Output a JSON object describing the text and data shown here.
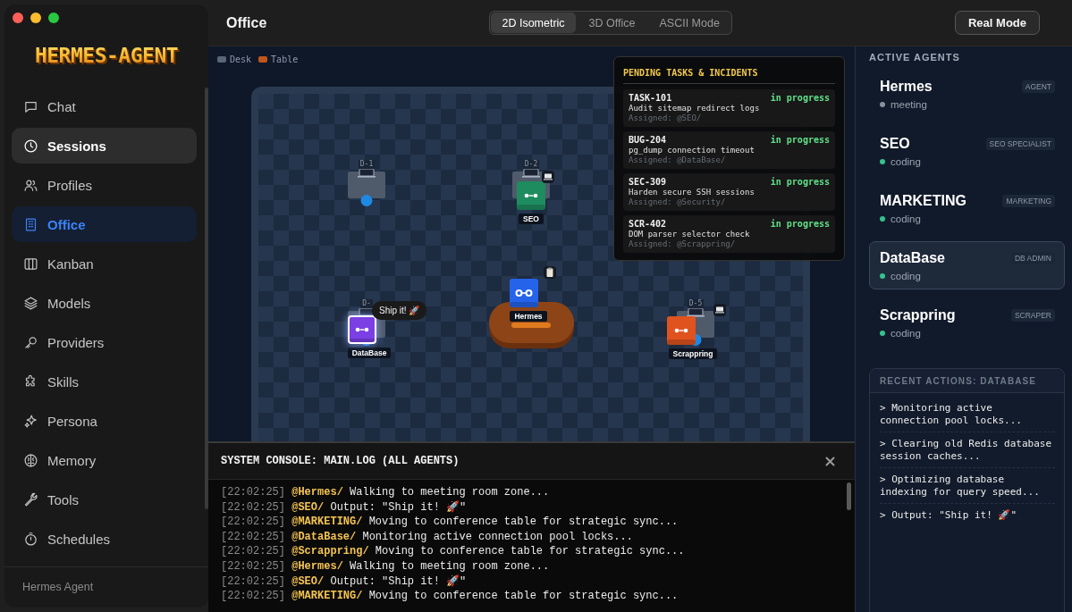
{
  "sidebar": {
    "logo": "HERMES-AGENT",
    "items": [
      {
        "label": "Chat",
        "selected": false,
        "hovered": false
      },
      {
        "label": "Sessions",
        "selected": false,
        "hovered": true
      },
      {
        "label": "Profiles",
        "selected": false,
        "hovered": false
      },
      {
        "label": "Office",
        "selected": true,
        "hovered": false
      },
      {
        "label": "Kanban",
        "selected": false,
        "hovered": false
      },
      {
        "label": "Models",
        "selected": false,
        "hovered": false
      },
      {
        "label": "Providers",
        "selected": false,
        "hovered": false
      },
      {
        "label": "Skills",
        "selected": false,
        "hovered": false
      },
      {
        "label": "Persona",
        "selected": false,
        "hovered": false
      },
      {
        "label": "Memory",
        "selected": false,
        "hovered": false
      },
      {
        "label": "Tools",
        "selected": false,
        "hovered": false
      },
      {
        "label": "Schedules",
        "selected": false,
        "hovered": false
      }
    ],
    "footer": "Hermes Agent"
  },
  "header": {
    "title": "Office",
    "view_tabs": [
      {
        "label": "2D Isometric",
        "selected": true
      },
      {
        "label": "3D Office",
        "selected": false
      },
      {
        "label": "ASCII Mode",
        "selected": false
      }
    ],
    "mode_button": "Real Mode"
  },
  "office": {
    "legend": [
      {
        "label": "Desk",
        "color": "#5a6578"
      },
      {
        "label": "Table",
        "color": "#c2551b"
      }
    ],
    "desks": [
      {
        "label": "D-1"
      },
      {
        "label": "D-2"
      },
      {
        "label": "D-"
      },
      {
        "label": "D-5"
      }
    ],
    "agents": [
      {
        "name": "SEO",
        "color": "#1e8c5e",
        "kind": "dots",
        "selected": false
      },
      {
        "name": "Hermes",
        "color": "#2563eb",
        "kind": "rings",
        "selected": false
      },
      {
        "name": "DataBase",
        "color": "#7b3fe4",
        "kind": "dots",
        "selected": true,
        "bubble": "Ship it! 🚀"
      },
      {
        "name": "Scrappring",
        "color": "#e0531f",
        "kind": "dots",
        "selected": false
      }
    ],
    "tasks_panel": {
      "title": "PENDING TASKS & INCIDENTS",
      "tasks": [
        {
          "id": "TASK-101",
          "status": "in progress",
          "description": "Audit sitemap redirect logs",
          "assigned": "Assigned: @SEO/"
        },
        {
          "id": "BUG-204",
          "status": "in progress",
          "description": "pg_dump connection timeout",
          "assigned": "Assigned: @DataBase/"
        },
        {
          "id": "SEC-309",
          "status": "in progress",
          "description": "Harden secure SSH sessions",
          "assigned": "Assigned: @Security/"
        },
        {
          "id": "SCR-402",
          "status": "in progress",
          "description": "DOM parser selector check",
          "assigned": "Assigned: @Scrappring/"
        }
      ]
    }
  },
  "console": {
    "title": "SYSTEM CONSOLE: MAIN.LOG (ALL AGENTS)",
    "lines": [
      {
        "time": "[22:02:25]",
        "agent": "@Hermes/",
        "message": "Walking to meeting room zone..."
      },
      {
        "time": "[22:02:25]",
        "agent": "@SEO/",
        "message": "Output: \"Ship it! 🚀\""
      },
      {
        "time": "[22:02:25]",
        "agent": "@MARKETING/",
        "message": "Moving to conference table for strategic sync..."
      },
      {
        "time": "[22:02:25]",
        "agent": "@DataBase/",
        "message": "Monitoring active connection pool locks..."
      },
      {
        "time": "[22:02:25]",
        "agent": "@Scrappring/",
        "message": "Moving to conference table for strategic sync..."
      },
      {
        "time": "[22:02:25]",
        "agent": "@Hermes/",
        "message": "Walking to meeting room zone..."
      },
      {
        "time": "[22:02:25]",
        "agent": "@SEO/",
        "message": "Output: \"Ship it! 🚀\""
      },
      {
        "time": "[22:02:25]",
        "agent": "@MARKETING/",
        "message": "Moving to conference table for strategic sync..."
      }
    ]
  },
  "agents_panel": {
    "title": "ACTIVE AGENTS",
    "agents": [
      {
        "name": "Hermes",
        "role": "AGENT",
        "status": "meeting",
        "color": "#8b919b",
        "selected": false
      },
      {
        "name": "SEO",
        "role": "SEO SPECIALIST",
        "status": "coding",
        "color": "#34c38f",
        "selected": false
      },
      {
        "name": "MARKETING",
        "role": "MARKETING",
        "status": "coding",
        "color": "#34c38f",
        "selected": false
      },
      {
        "name": "DataBase",
        "role": "DB ADMIN",
        "status": "coding",
        "color": "#34c38f",
        "selected": true
      },
      {
        "name": "Scrappring",
        "role": "SCRAPER",
        "status": "coding",
        "color": "#34c38f",
        "selected": false
      }
    ],
    "recent_actions": {
      "title": "RECENT ACTIONS: DATABASE",
      "items": [
        "> Monitoring active connection pool locks...",
        "> Clearing old Redis database session caches...",
        "> Optimizing database indexing for query speed...",
        "> Output: \"Ship it! 🚀\""
      ]
    }
  }
}
